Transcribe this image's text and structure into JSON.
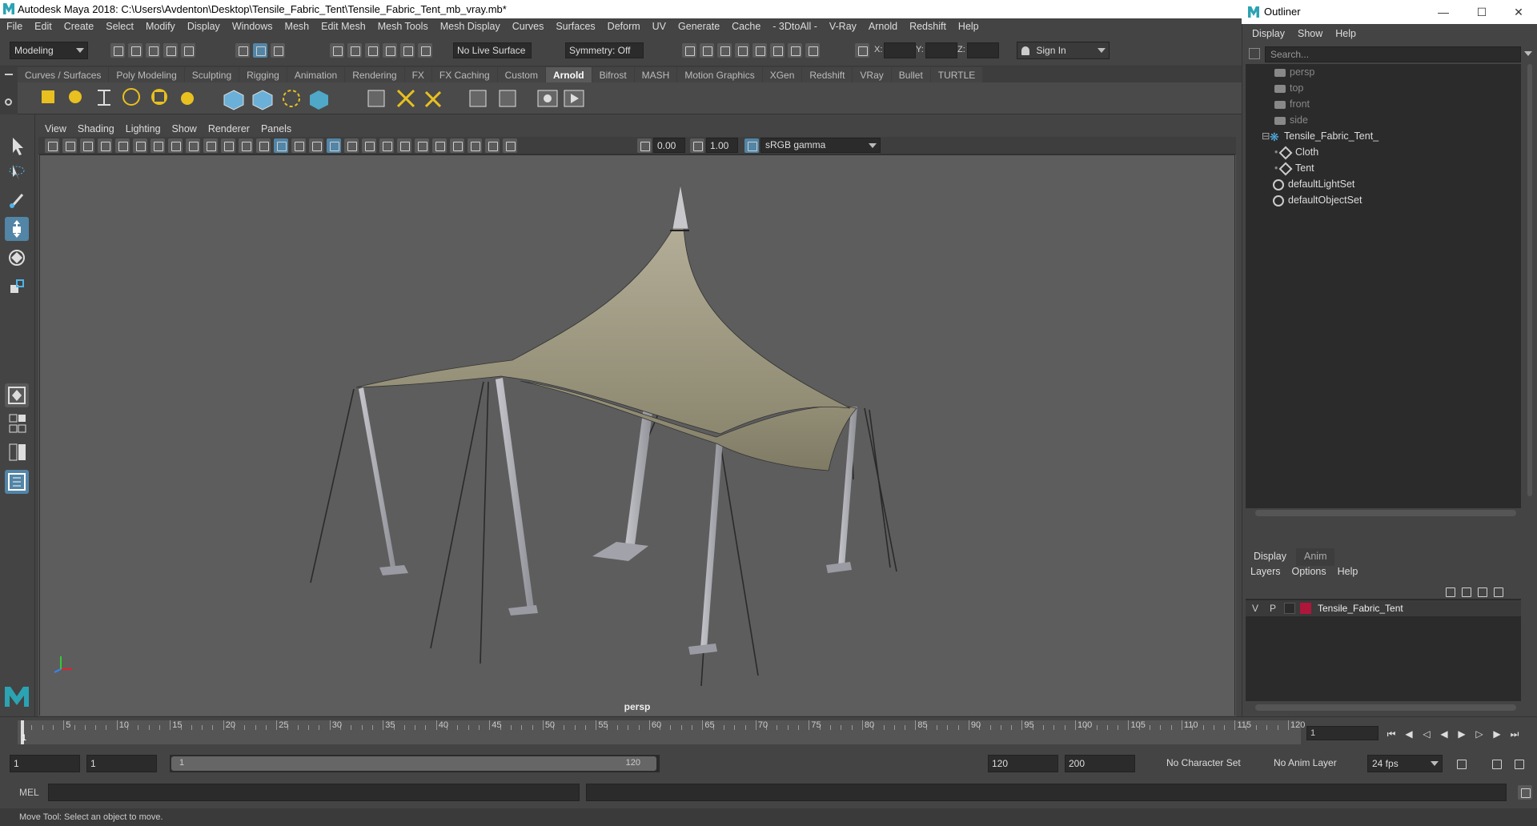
{
  "window": {
    "title": "Autodesk Maya 2018: C:\\Users\\Avdenton\\Desktop\\Tensile_Fabric_Tent\\Tensile_Fabric_Tent_mb_vray.mb*"
  },
  "menubar": [
    "File",
    "Edit",
    "Create",
    "Select",
    "Modify",
    "Display",
    "Windows",
    "Mesh",
    "Edit Mesh",
    "Mesh Tools",
    "Mesh Display",
    "Curves",
    "Surfaces",
    "Deform",
    "UV",
    "Generate",
    "Cache",
    "- 3DtoAll -",
    "V-Ray",
    "Arnold",
    "Redshift",
    "Help"
  ],
  "statusline": {
    "mode": "Modeling",
    "live_surface": "No Live Surface",
    "symmetry": "Symmetry: Off",
    "x_label": "X:",
    "y_label": "Y:",
    "z_label": "Z:",
    "sign_in": "Sign In"
  },
  "shelf_tabs": [
    "Curves / Surfaces",
    "Poly Modeling",
    "Sculpting",
    "Rigging",
    "Animation",
    "Rendering",
    "FX",
    "FX Caching",
    "Custom",
    "Arnold",
    "Bifrost",
    "MASH",
    "Motion Graphics",
    "XGen",
    "Redshift",
    "VRay",
    "Bullet",
    "TURTLE"
  ],
  "shelf_active": "Arnold",
  "viewport": {
    "menu": [
      "View",
      "Shading",
      "Lighting",
      "Show",
      "Renderer",
      "Panels"
    ],
    "exposure": "0.00",
    "gamma": "1.00",
    "color_space": "sRGB gamma",
    "camera_label": "persp"
  },
  "outliner": {
    "title": "Outliner",
    "menu": [
      "Display",
      "Show",
      "Help"
    ],
    "search_placeholder": "Search...",
    "items": [
      {
        "label": "persp",
        "kind": "camera",
        "dim": true
      },
      {
        "label": "top",
        "kind": "camera",
        "dim": true
      },
      {
        "label": "front",
        "kind": "camera",
        "dim": true
      },
      {
        "label": "side",
        "kind": "camera",
        "dim": true
      },
      {
        "label": "Tensile_Fabric_Tent_",
        "kind": "group",
        "dim": false
      },
      {
        "label": "Cloth",
        "kind": "mesh",
        "dim": false
      },
      {
        "label": "Tent",
        "kind": "mesh",
        "dim": false
      },
      {
        "label": "defaultLightSet",
        "kind": "set",
        "dim": false
      },
      {
        "label": "defaultObjectSet",
        "kind": "set",
        "dim": false
      }
    ]
  },
  "layers": {
    "tabs": [
      "Display",
      "Anim"
    ],
    "menu": [
      "Layers",
      "Options",
      "Help"
    ],
    "row": {
      "v": "V",
      "p": "P",
      "name": "Tensile_Fabric_Tent",
      "color": "#b0163a"
    }
  },
  "timeline": {
    "ticks": [
      "5",
      "10",
      "15",
      "20",
      "25",
      "30",
      "35",
      "40",
      "45",
      "50",
      "55",
      "60",
      "65",
      "70",
      "75",
      "80",
      "85",
      "90",
      "95",
      "100",
      "105",
      "110",
      "115",
      "120"
    ],
    "start_marker": "1",
    "current_frame": "1"
  },
  "range": {
    "start": "1",
    "playback_start": "1",
    "slider_start": "1",
    "slider_end": "120",
    "playback_end": "120",
    "end": "200",
    "character_set": "No Character Set",
    "anim_layer": "No Anim Layer",
    "fps": "24 fps"
  },
  "command": {
    "label": "MEL"
  },
  "helpline": {
    "text": "Move Tool: Select an object to move."
  },
  "colors": {
    "accent": "#5285a6",
    "maya_teal": "#2ba3b3",
    "fabric": "#b8b29a",
    "pole": "#a8a8b0"
  }
}
